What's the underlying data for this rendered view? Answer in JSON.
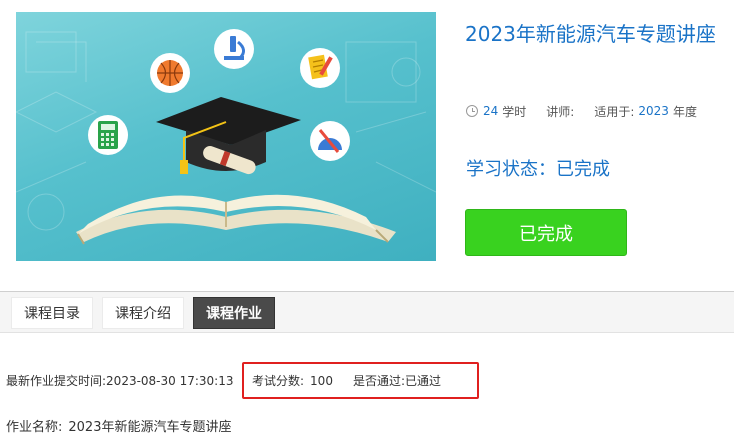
{
  "course": {
    "title": "2023年新能源汽车专题讲座",
    "hours_value": "24",
    "hours_unit": "学时",
    "lecturer_label": "讲师:",
    "applies_label": "适用于:",
    "applies_year": "2023",
    "applies_unit": "年度",
    "study_status": "学习状态：已完成",
    "status_button": "已完成"
  },
  "tabs": [
    {
      "label": "课程目录"
    },
    {
      "label": "课程介绍"
    },
    {
      "label": "课程作业",
      "active": true
    }
  ],
  "homework": {
    "submit_time_label": "最新作业提交时间:",
    "submit_time_value": "2023-08-30 17:30:13",
    "score_label": "考试分数:",
    "score_value": "100",
    "passed_label": "是否通过:",
    "passed_value": "已通过",
    "name_label": "作业名称:",
    "name_value": "2023年新能源汽车专题讲座"
  },
  "colors": {
    "link_blue": "#1a73c7",
    "done_green": "#39d21f",
    "highlight_red": "#e0201f",
    "active_tab": "#4a4a4a"
  },
  "icons": [
    "calculator-icon",
    "basketball-icon",
    "microscope-icon",
    "notepad-pencil-icon",
    "protractor-icon",
    "graduation-cap-icon",
    "open-book-icon",
    "clock-icon"
  ]
}
